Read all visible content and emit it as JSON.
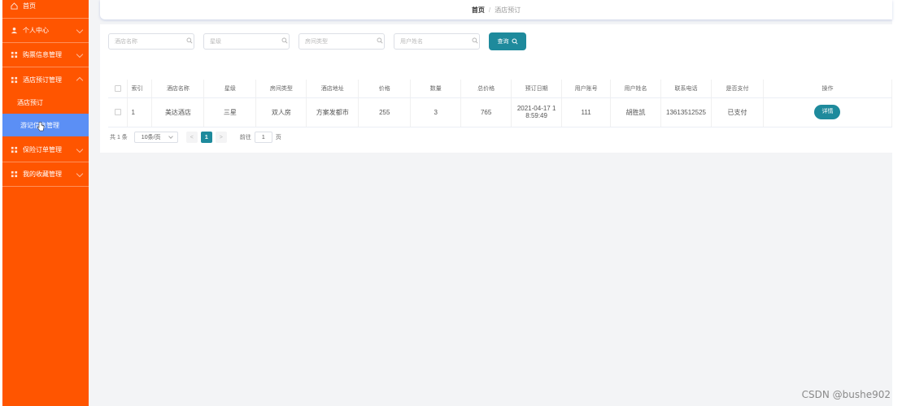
{
  "sidebar": {
    "items": [
      {
        "label": "首页",
        "icon": "home-icon"
      },
      {
        "label": "个人中心",
        "icon": "user-icon"
      },
      {
        "label": "购票信息管理",
        "icon": "grid-icon"
      },
      {
        "label": "酒店预订管理",
        "icon": "grid-icon"
      },
      {
        "label": "保险订单管理",
        "icon": "grid-icon"
      },
      {
        "label": "我的收藏管理",
        "icon": "grid-icon"
      }
    ],
    "subitems": [
      {
        "label": "酒店预订"
      },
      {
        "label": "游记信息管理",
        "active": true
      }
    ]
  },
  "breadcrumb": {
    "home": "首页",
    "separator": "/",
    "current": "酒店预订"
  },
  "search": {
    "hotel_name_placeholder": "酒店名称",
    "star_placeholder": "星级",
    "room_type_placeholder": "房间类型",
    "user_name_placeholder": "用户姓名",
    "query_label": "查询"
  },
  "table": {
    "headers": [
      "索引",
      "酒店名称",
      "星级",
      "房间类型",
      "酒店地址",
      "价格",
      "数量",
      "总价格",
      "预订日期",
      "用户账号",
      "用户姓名",
      "联系电话",
      "是否支付",
      "操作"
    ],
    "rows": [
      {
        "index": "1",
        "hotel_name": "美达酒店",
        "star": "三星",
        "room_type": "双人房",
        "address": "方案发都市",
        "price": "255",
        "quantity": "3",
        "total": "765",
        "date_line1": "2021-04-17 1",
        "date_line2": "8:59:49",
        "account": "111",
        "user_name": "胡胜凯",
        "phone": "13613512525",
        "paid": "已支付",
        "action": "详情"
      }
    ]
  },
  "pager": {
    "total": "共 1 条",
    "page_size": "10条/页",
    "prev": "<",
    "current_page": "1",
    "next": ">",
    "goto_label": "前往",
    "goto_value": "1",
    "page_unit": "页"
  },
  "watermark": "CSDN @bushe902",
  "colors": {
    "sidebar": "#ff5500",
    "accent": "#1e8a9c",
    "active_menu": "#5b8ff5"
  }
}
